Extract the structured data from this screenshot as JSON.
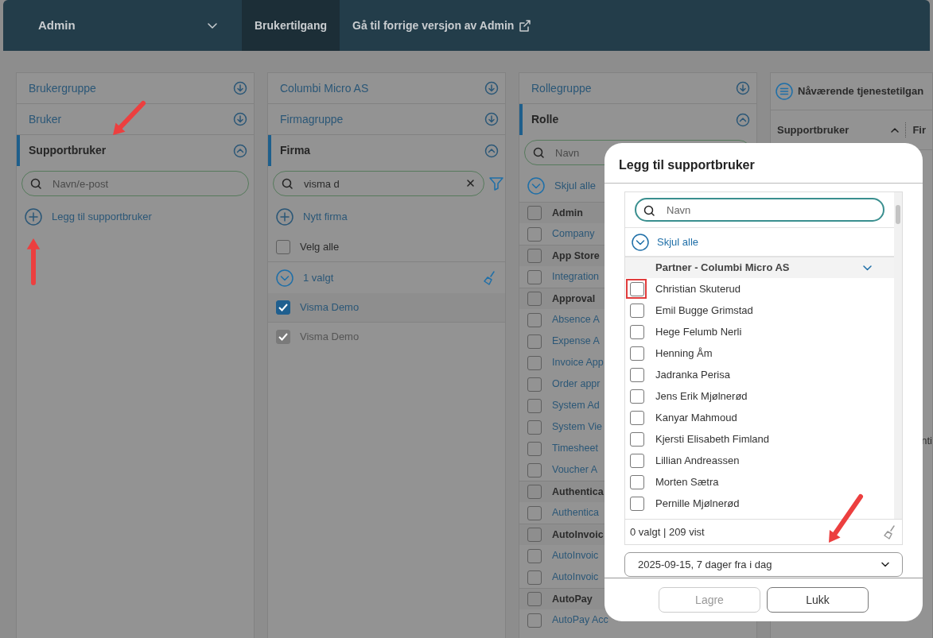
{
  "nav": {
    "brand": "Admin",
    "tabs": [
      {
        "label": "Brukertilgang",
        "selected": true,
        "external": false
      },
      {
        "label": "Gå til forrige versjon av Admin",
        "selected": false,
        "external": true
      }
    ]
  },
  "columns": [
    {
      "sections": [
        {
          "title": "Brukergruppe",
          "expanded": false
        },
        {
          "title": "Bruker",
          "expanded": false
        },
        {
          "title": "Supportbruker",
          "expanded": true
        }
      ],
      "body": [
        {
          "kind": "search",
          "placeholder": "Navn/e-post"
        },
        {
          "kind": "add",
          "label": "Legg til supportbruker"
        }
      ]
    },
    {
      "sections": [
        {
          "title": "Columbi Micro AS",
          "expanded": false
        },
        {
          "title": "Firmagruppe",
          "expanded": false
        },
        {
          "title": "Firma",
          "expanded": true
        }
      ],
      "body": [
        {
          "kind": "search",
          "value": "visma d",
          "clearable": true,
          "filter": true
        },
        {
          "kind": "add",
          "label": "Nytt firma"
        },
        {
          "kind": "check",
          "label": "Velg alle",
          "checked": false,
          "disabled": false
        },
        {
          "kind": "toggle",
          "label": "1 valgt",
          "broom": true
        },
        {
          "kind": "check",
          "label": "Visma Demo",
          "checked": true,
          "disabled": false
        },
        {
          "kind": "check",
          "label": "Visma Demo",
          "checked": true,
          "disabled": true
        }
      ]
    },
    {
      "sections": [
        {
          "title": "Rollegruppe",
          "expanded": false
        },
        {
          "title": "Rolle",
          "expanded": true
        }
      ],
      "body": [
        {
          "kind": "search",
          "placeholder": "Navn"
        },
        {
          "kind": "toggle",
          "label": "Skjul alle"
        },
        {
          "kind": "group",
          "label": "Admin",
          "checked": false
        },
        {
          "kind": "role",
          "label": "Company",
          "checked": false
        },
        {
          "kind": "group",
          "label": "App Store",
          "checked": false
        },
        {
          "kind": "role",
          "label": "Integration",
          "checked": false
        },
        {
          "kind": "group",
          "label": "Approval",
          "checked": false
        },
        {
          "kind": "role",
          "label": "Absence A",
          "checked": false
        },
        {
          "kind": "role",
          "label": "Expense A",
          "checked": false
        },
        {
          "kind": "role",
          "label": "Invoice App",
          "checked": false
        },
        {
          "kind": "role",
          "label": "Order appr",
          "checked": false
        },
        {
          "kind": "role",
          "label": "System Ad",
          "checked": false
        },
        {
          "kind": "role",
          "label": "System Vie",
          "checked": false
        },
        {
          "kind": "role",
          "label": "Timesheet",
          "checked": false
        },
        {
          "kind": "role",
          "label": "Voucher A",
          "checked": false
        },
        {
          "kind": "group",
          "label": "Authentica",
          "checked": false
        },
        {
          "kind": "role",
          "label": "Authentica",
          "checked": false
        },
        {
          "kind": "group",
          "label": "AutoInvoic",
          "checked": false
        },
        {
          "kind": "role",
          "label": "AutoInvoic",
          "checked": false
        },
        {
          "kind": "role",
          "label": "AutoInvoic",
          "checked": false
        },
        {
          "kind": "group",
          "label": "AutoPay",
          "checked": false
        },
        {
          "kind": "role",
          "label": "AutoPay Acc",
          "checked": false
        }
      ]
    }
  ],
  "access_panel": {
    "title": "Nåværende tjenestetilgan",
    "columns": [
      {
        "label": "Supportbruker",
        "sorted": true
      },
      {
        "label": "Fir",
        "sorted": false
      }
    ],
    "column_text": "nti"
  },
  "modal": {
    "title": "Legg til supportbruker",
    "search": {
      "placeholder": "Navn"
    },
    "toggle": "Skjul alle",
    "group": "Partner - Columbi Micro AS",
    "users": [
      {
        "name": "Christian Skuterud",
        "checked": false,
        "highlighted": true
      },
      {
        "name": "Emil Bugge Grimstad",
        "checked": false,
        "highlighted": false
      },
      {
        "name": "Hege Felumb Nerli",
        "checked": false,
        "highlighted": false
      },
      {
        "name": "Henning Åm",
        "checked": false,
        "highlighted": false
      },
      {
        "name": "Jadranka Perisa",
        "checked": false,
        "highlighted": false
      },
      {
        "name": "Jens Erik Mjølnerød",
        "checked": false,
        "highlighted": false
      },
      {
        "name": "Kanyar Mahmoud",
        "checked": false,
        "highlighted": false
      },
      {
        "name": "Kjersti Elisabeth Fimland",
        "checked": false,
        "highlighted": false
      },
      {
        "name": "Lillian Andreassen",
        "checked": false,
        "highlighted": false
      },
      {
        "name": "Morten Sætra",
        "checked": false,
        "highlighted": false
      },
      {
        "name": "Pernille Mjølnerød",
        "checked": false,
        "highlighted": false
      }
    ],
    "summary": "0 valgt | 209 vist",
    "expiry": "2025-09-15, 7 dager fra i dag",
    "buttons": [
      {
        "label": "Lagre",
        "disabled": true
      },
      {
        "label": "Lukk",
        "disabled": false
      }
    ]
  }
}
